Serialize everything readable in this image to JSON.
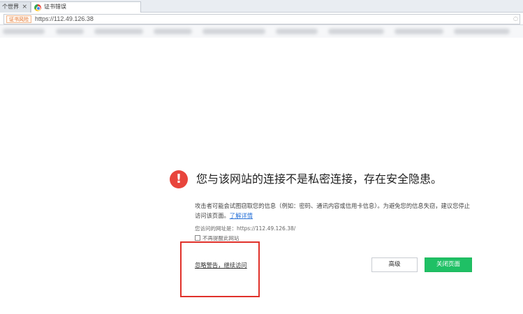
{
  "tabs": [
    {
      "label": "个世界",
      "close": "×"
    },
    {
      "label": "证书错误"
    }
  ],
  "address_bar": {
    "badge": "证书风险",
    "url": "https://112.49.126.38",
    "url_icon": "circle-icon"
  },
  "error": {
    "icon": "!",
    "title": "您与该网站的连接不是私密连接，存在安全隐患。",
    "description": "攻击者可能会试图窃取您的信息（例如：密码、通讯内容或信用卡信息）。为避免您的信息失窃，建议您停止访问该页面。",
    "learn_more": "了解详情",
    "visited_url": "您访问的网址是：https://112.49.126.38/",
    "remember_label": "不再提醒此网站",
    "ignore_link": "忽略警告，继续访问",
    "advanced_button": "高级",
    "close_button": "关闭页面"
  },
  "colors": {
    "close_button": "#1fc065",
    "warning_icon": "#e8453c",
    "highlight_box": "#e0312a",
    "link": "#2b73d8"
  }
}
